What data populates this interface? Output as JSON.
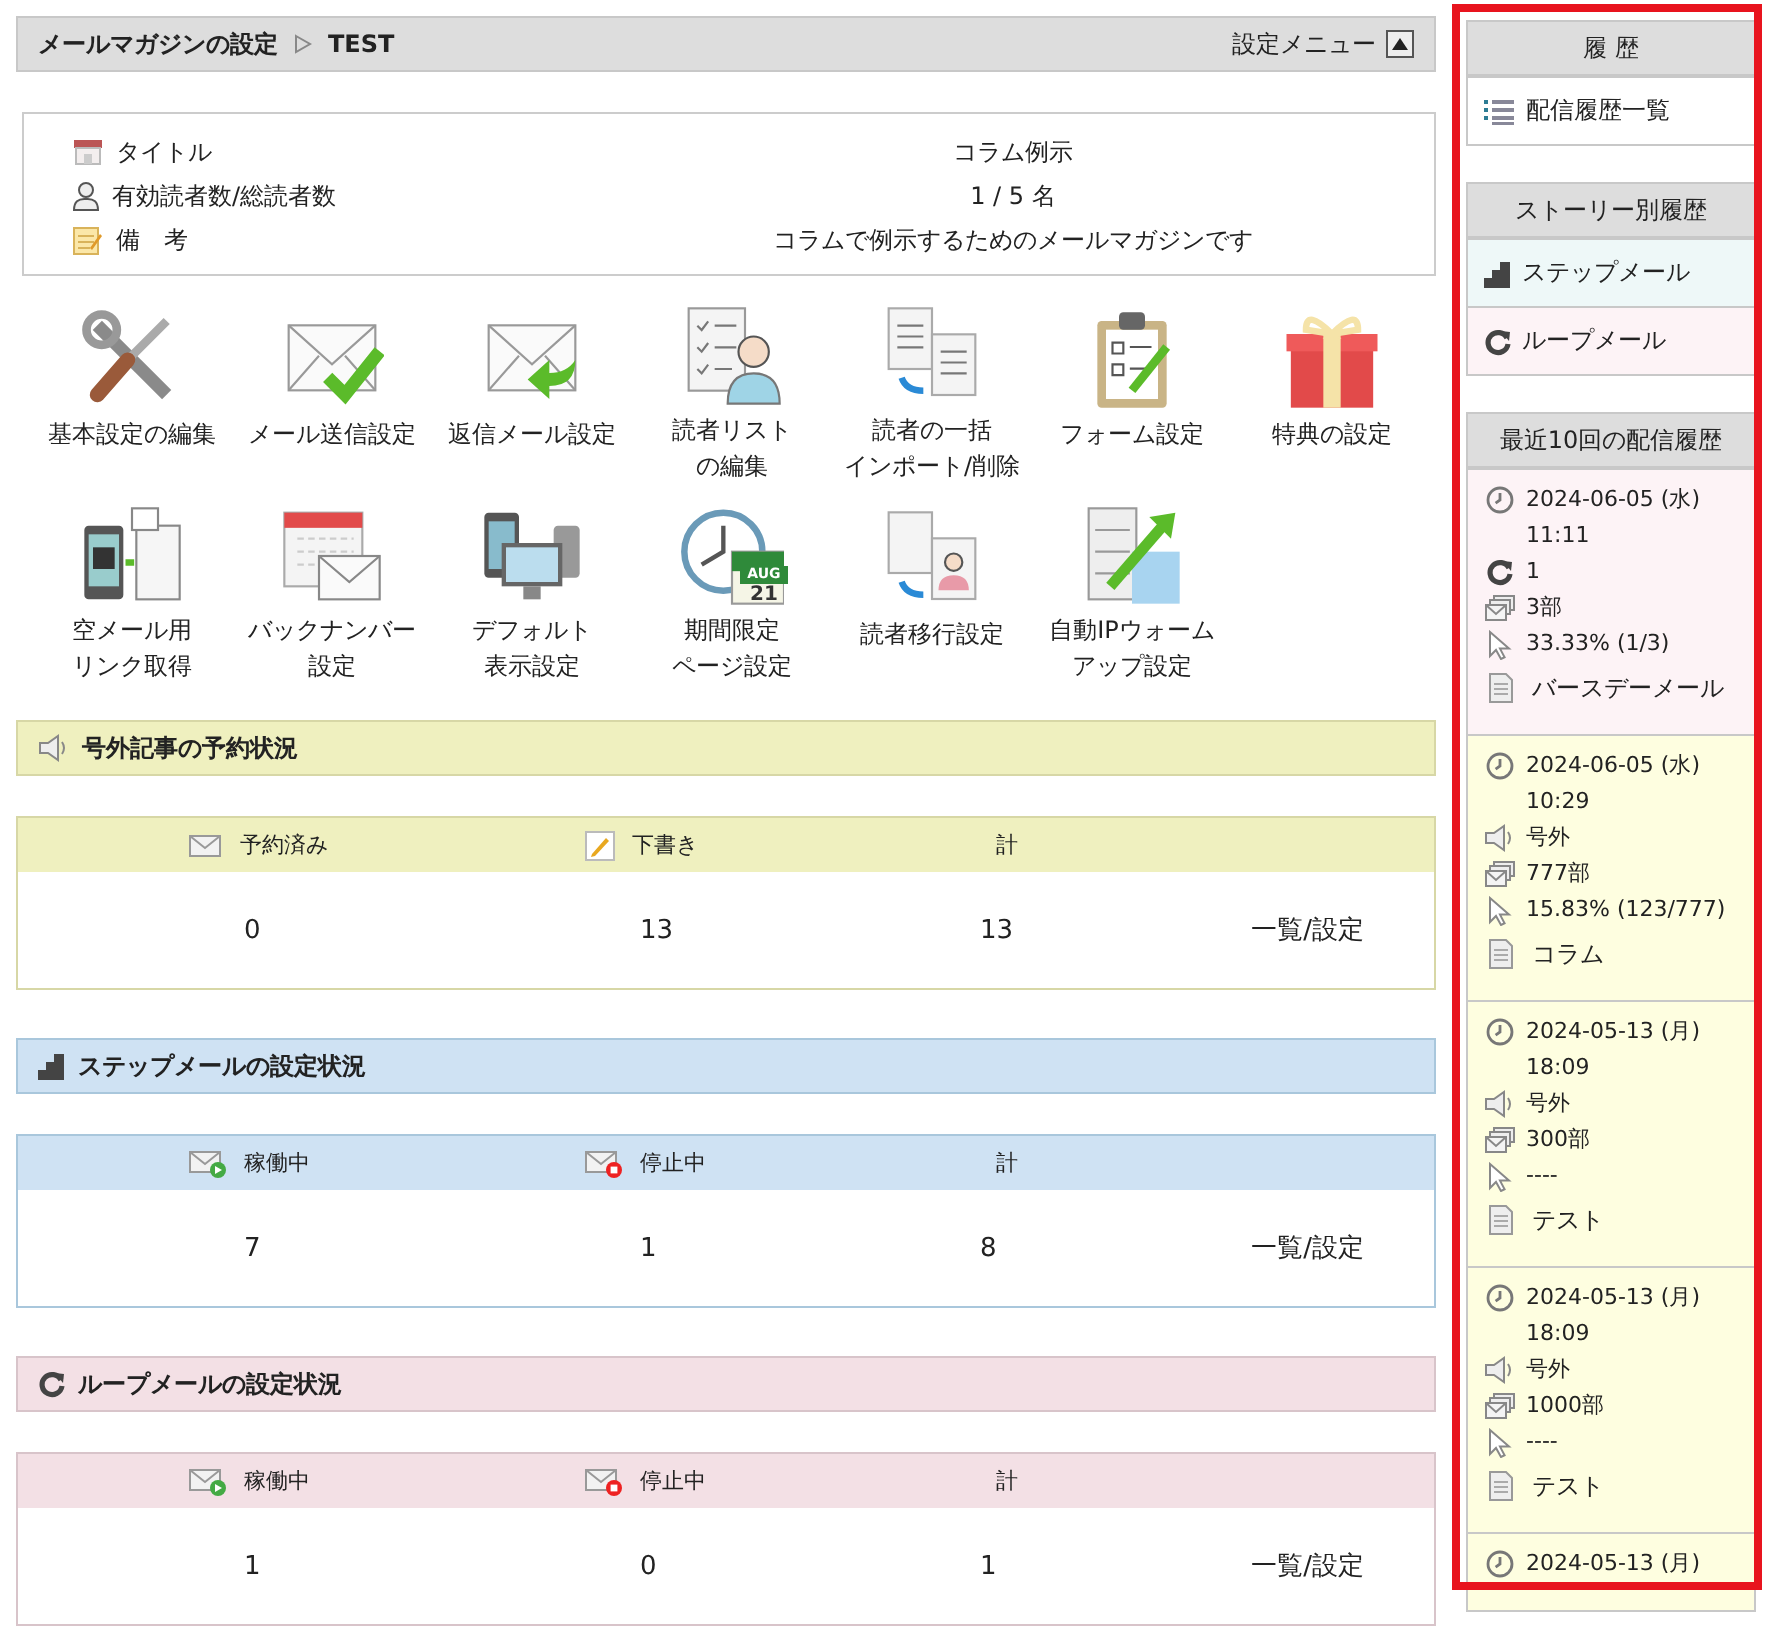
{
  "header": {
    "title": "メールマガジンの設定",
    "crumb": "TEST",
    "menu_label": "設定メニュー"
  },
  "info": [
    {
      "kind": "title",
      "label": "タイトル",
      "value": "コラム例示"
    },
    {
      "kind": "readers",
      "label": "有効読者数/総読者数",
      "value": "1 / 5 名"
    },
    {
      "kind": "note",
      "label": "備　考",
      "value": "コラムで例示するためのメールマガジンです"
    }
  ],
  "menu": [
    {
      "kind": "tools",
      "lines": [
        "基本設定の編集"
      ]
    },
    {
      "kind": "send",
      "lines": [
        "メール送信設定"
      ]
    },
    {
      "kind": "reply",
      "lines": [
        "返信メール設定"
      ]
    },
    {
      "kind": "readers",
      "lines": [
        "読者リスト",
        "の編集"
      ]
    },
    {
      "kind": "import",
      "lines": [
        "読者の一括",
        "インポート/削除"
      ]
    },
    {
      "kind": "form",
      "lines": [
        "フォーム設定"
      ]
    },
    {
      "kind": "gift",
      "lines": [
        "特典の設定"
      ]
    },
    {
      "kind": "qr",
      "lines": [
        "空メール用",
        "リンク取得"
      ]
    },
    {
      "kind": "backnumber",
      "lines": [
        "バックナンバー",
        "設定"
      ]
    },
    {
      "kind": "devices",
      "lines": [
        "デフォルト",
        "表示設定"
      ]
    },
    {
      "kind": "calendar",
      "lines": [
        "期間限定",
        "ページ設定"
      ],
      "badge_month": "AUG",
      "badge_day": "21"
    },
    {
      "kind": "migrate",
      "lines": [
        "読者移行設定"
      ]
    },
    {
      "kind": "warmup",
      "lines": [
        "自動IPウォーム",
        "アップ設定"
      ]
    }
  ],
  "sections": [
    {
      "kind": "extra",
      "title": "号外記事の予約状況",
      "columns": [
        {
          "kind": "reserved",
          "label": "予約済み"
        },
        {
          "kind": "draft",
          "label": "下書き"
        },
        {
          "kind": "total",
          "label": "計"
        }
      ],
      "values": [
        "0",
        "13",
        "13"
      ],
      "link": "一覧/設定"
    },
    {
      "kind": "step",
      "title": "ステップメールの設定状況",
      "columns": [
        {
          "kind": "active",
          "label": "稼働中"
        },
        {
          "kind": "stopped",
          "label": "停止中"
        },
        {
          "kind": "total",
          "label": "計"
        }
      ],
      "values": [
        "7",
        "1",
        "8"
      ],
      "link": "一覧/設定"
    },
    {
      "kind": "loop",
      "title": "ループメールの設定状況",
      "columns": [
        {
          "kind": "active",
          "label": "稼働中"
        },
        {
          "kind": "stopped",
          "label": "停止中"
        },
        {
          "kind": "total",
          "label": "計"
        }
      ],
      "values": [
        "1",
        "0",
        "1"
      ],
      "link": "一覧/設定"
    }
  ],
  "sidebar": {
    "history": {
      "title": "履 歴",
      "items": [
        {
          "label": "配信履歴一覧"
        }
      ]
    },
    "stories": {
      "title": "ストーリー別履歴",
      "items": [
        {
          "kind": "step",
          "label": "ステップメール"
        },
        {
          "kind": "loop",
          "label": "ループメール"
        }
      ]
    },
    "recent": {
      "title": "最近10回の配信履歴",
      "items": [
        {
          "kind": "loop",
          "date": "2024-06-05 (水)",
          "time": "11:11",
          "type_label": "1",
          "copies": "3部",
          "rate": "33.33% (1/3)",
          "subject": "バースデーメール"
        },
        {
          "kind": "extra",
          "date": "2024-06-05 (水)",
          "time": "10:29",
          "type_label": "号外",
          "copies": "777部",
          "rate": "15.83% (123/777)",
          "subject": "コラム"
        },
        {
          "kind": "extra",
          "date": "2024-05-13 (月)",
          "time": "18:09",
          "type_label": "号外",
          "copies": "300部",
          "rate": "----",
          "subject": "テスト"
        },
        {
          "kind": "extra",
          "date": "2024-05-13 (月)",
          "time": "18:09",
          "type_label": "号外",
          "copies": "1000部",
          "rate": "----",
          "subject": "テスト"
        },
        {
          "kind": "extra",
          "date": "2024-05-13 (月)"
        }
      ]
    }
  },
  "highlight": {
    "on": true
  }
}
